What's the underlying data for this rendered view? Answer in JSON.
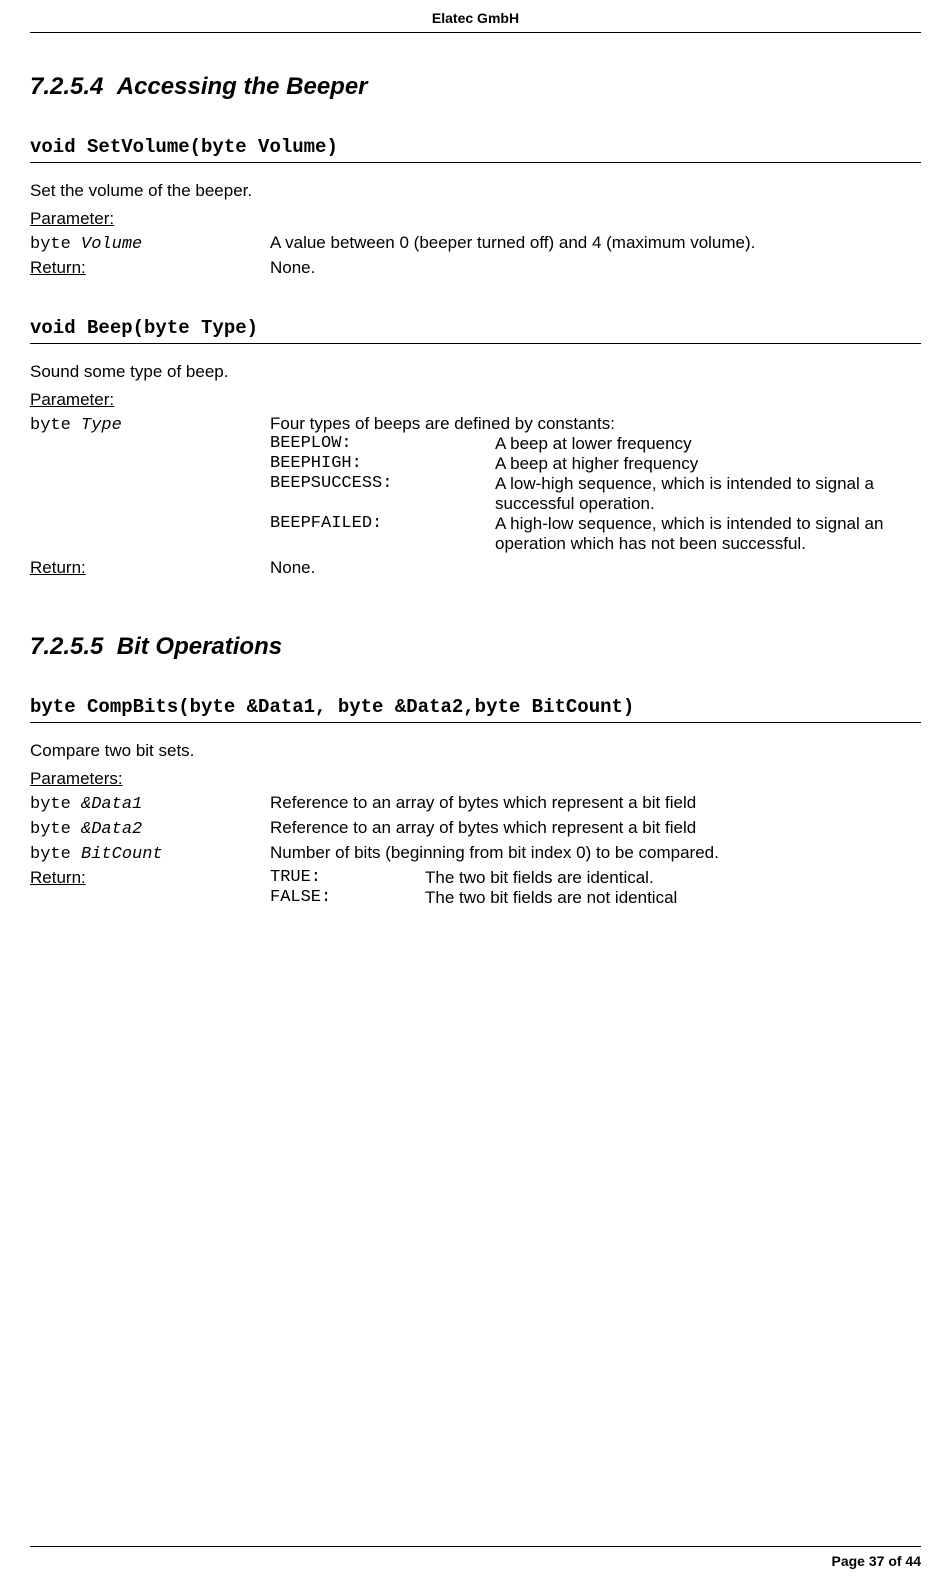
{
  "header": {
    "company": "Elatec GmbH"
  },
  "sections": {
    "s1": {
      "number": "7.2.5.4",
      "title": "Accessing the Beeper"
    },
    "s2": {
      "number": "7.2.5.5",
      "title": "Bit Operations"
    }
  },
  "functions": {
    "setVolume": {
      "signature": "void SetVolume(byte Volume)",
      "description": "Set the volume of the beeper.",
      "labels": {
        "parameter": "Parameter:",
        "return": "Return:"
      },
      "params": {
        "volume": {
          "type": "byte ",
          "name": "Volume",
          "desc": "A value between 0 (beeper turned off) and 4 (maximum volume)."
        }
      },
      "returnVal": "None."
    },
    "beep": {
      "signature": "void Beep(byte Type)",
      "description": "Sound some type of beep.",
      "labels": {
        "parameter": "Parameter:",
        "return": "Return:"
      },
      "params": {
        "type": {
          "type": "byte ",
          "name": "Type",
          "desc": "Four types of beeps are defined by constants:",
          "constants": {
            "low": {
              "key": "BEEPLOW:",
              "val": "A beep at lower frequency"
            },
            "high": {
              "key": "BEEPHIGH:",
              "val": "A beep at higher frequency"
            },
            "success": {
              "key": "BEEPSUCCESS:",
              "val": "A low-high sequence, which is intended to signal a successful operation."
            },
            "failed": {
              "key": "BEEPFAILED:",
              "val": "A high-low sequence, which is intended to signal an operation which has not been successful."
            }
          }
        }
      },
      "returnVal": "None."
    },
    "compBits": {
      "signature": "byte CompBits(byte &Data1, byte &Data2,byte BitCount)",
      "description": "Compare two bit sets.",
      "labels": {
        "parameters": "Parameters:",
        "return": "Return:"
      },
      "params": {
        "data1": {
          "type": "byte ",
          "name": "&Data1",
          "desc": "Reference to an array of bytes which represent a bit field"
        },
        "data2": {
          "type": "byte ",
          "name": "&Data2",
          "desc": "Reference to an array of bytes which represent a bit field"
        },
        "bitCount": {
          "type": "byte ",
          "name": "BitCount",
          "desc": "Number of bits (beginning from bit index 0) to be compared."
        }
      },
      "returnVals": {
        "true": {
          "key": "TRUE:",
          "val": "The two bit fields are identical."
        },
        "false": {
          "key": "FALSE:",
          "val": "The two bit fields are not identical"
        }
      }
    }
  },
  "footer": {
    "pageText": "Page 37 of 44"
  }
}
